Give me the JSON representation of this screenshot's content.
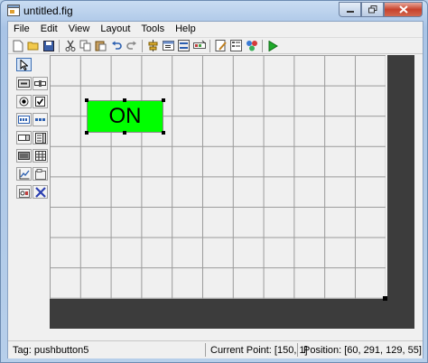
{
  "window": {
    "title": "untitled.fig"
  },
  "menu": [
    "File",
    "Edit",
    "View",
    "Layout",
    "Tools",
    "Help"
  ],
  "toolbar": {
    "icons": [
      "new-file-icon",
      "open-folder-icon",
      "save-icon",
      "cut-icon",
      "copy-icon",
      "paste-icon",
      "undo-icon",
      "redo-icon",
      "align-icon",
      "menu-editor-icon",
      "tab-order-icon",
      "toolbar-editor-icon",
      "mfile-editor-icon",
      "property-inspector-icon",
      "object-browser-icon",
      "run-icon"
    ]
  },
  "palette": {
    "icons": [
      "select-arrow-icon",
      "push-button-icon",
      "slider-icon",
      "radio-button-icon",
      "check-box-icon",
      "edit-text-icon",
      "static-text-icon",
      "popup-menu-icon",
      "listbox-icon",
      "toggle-button-icon",
      "table-icon",
      "axes-icon",
      "panel-icon",
      "button-group-icon",
      "activex-icon"
    ]
  },
  "canvas": {
    "button_label": "ON",
    "button_color": "#00ff00"
  },
  "status": {
    "tag": "Tag: pushbutton5",
    "current_point": "Current Point:  [150, 1]",
    "position": "Position: [60, 291, 129, 55]"
  }
}
